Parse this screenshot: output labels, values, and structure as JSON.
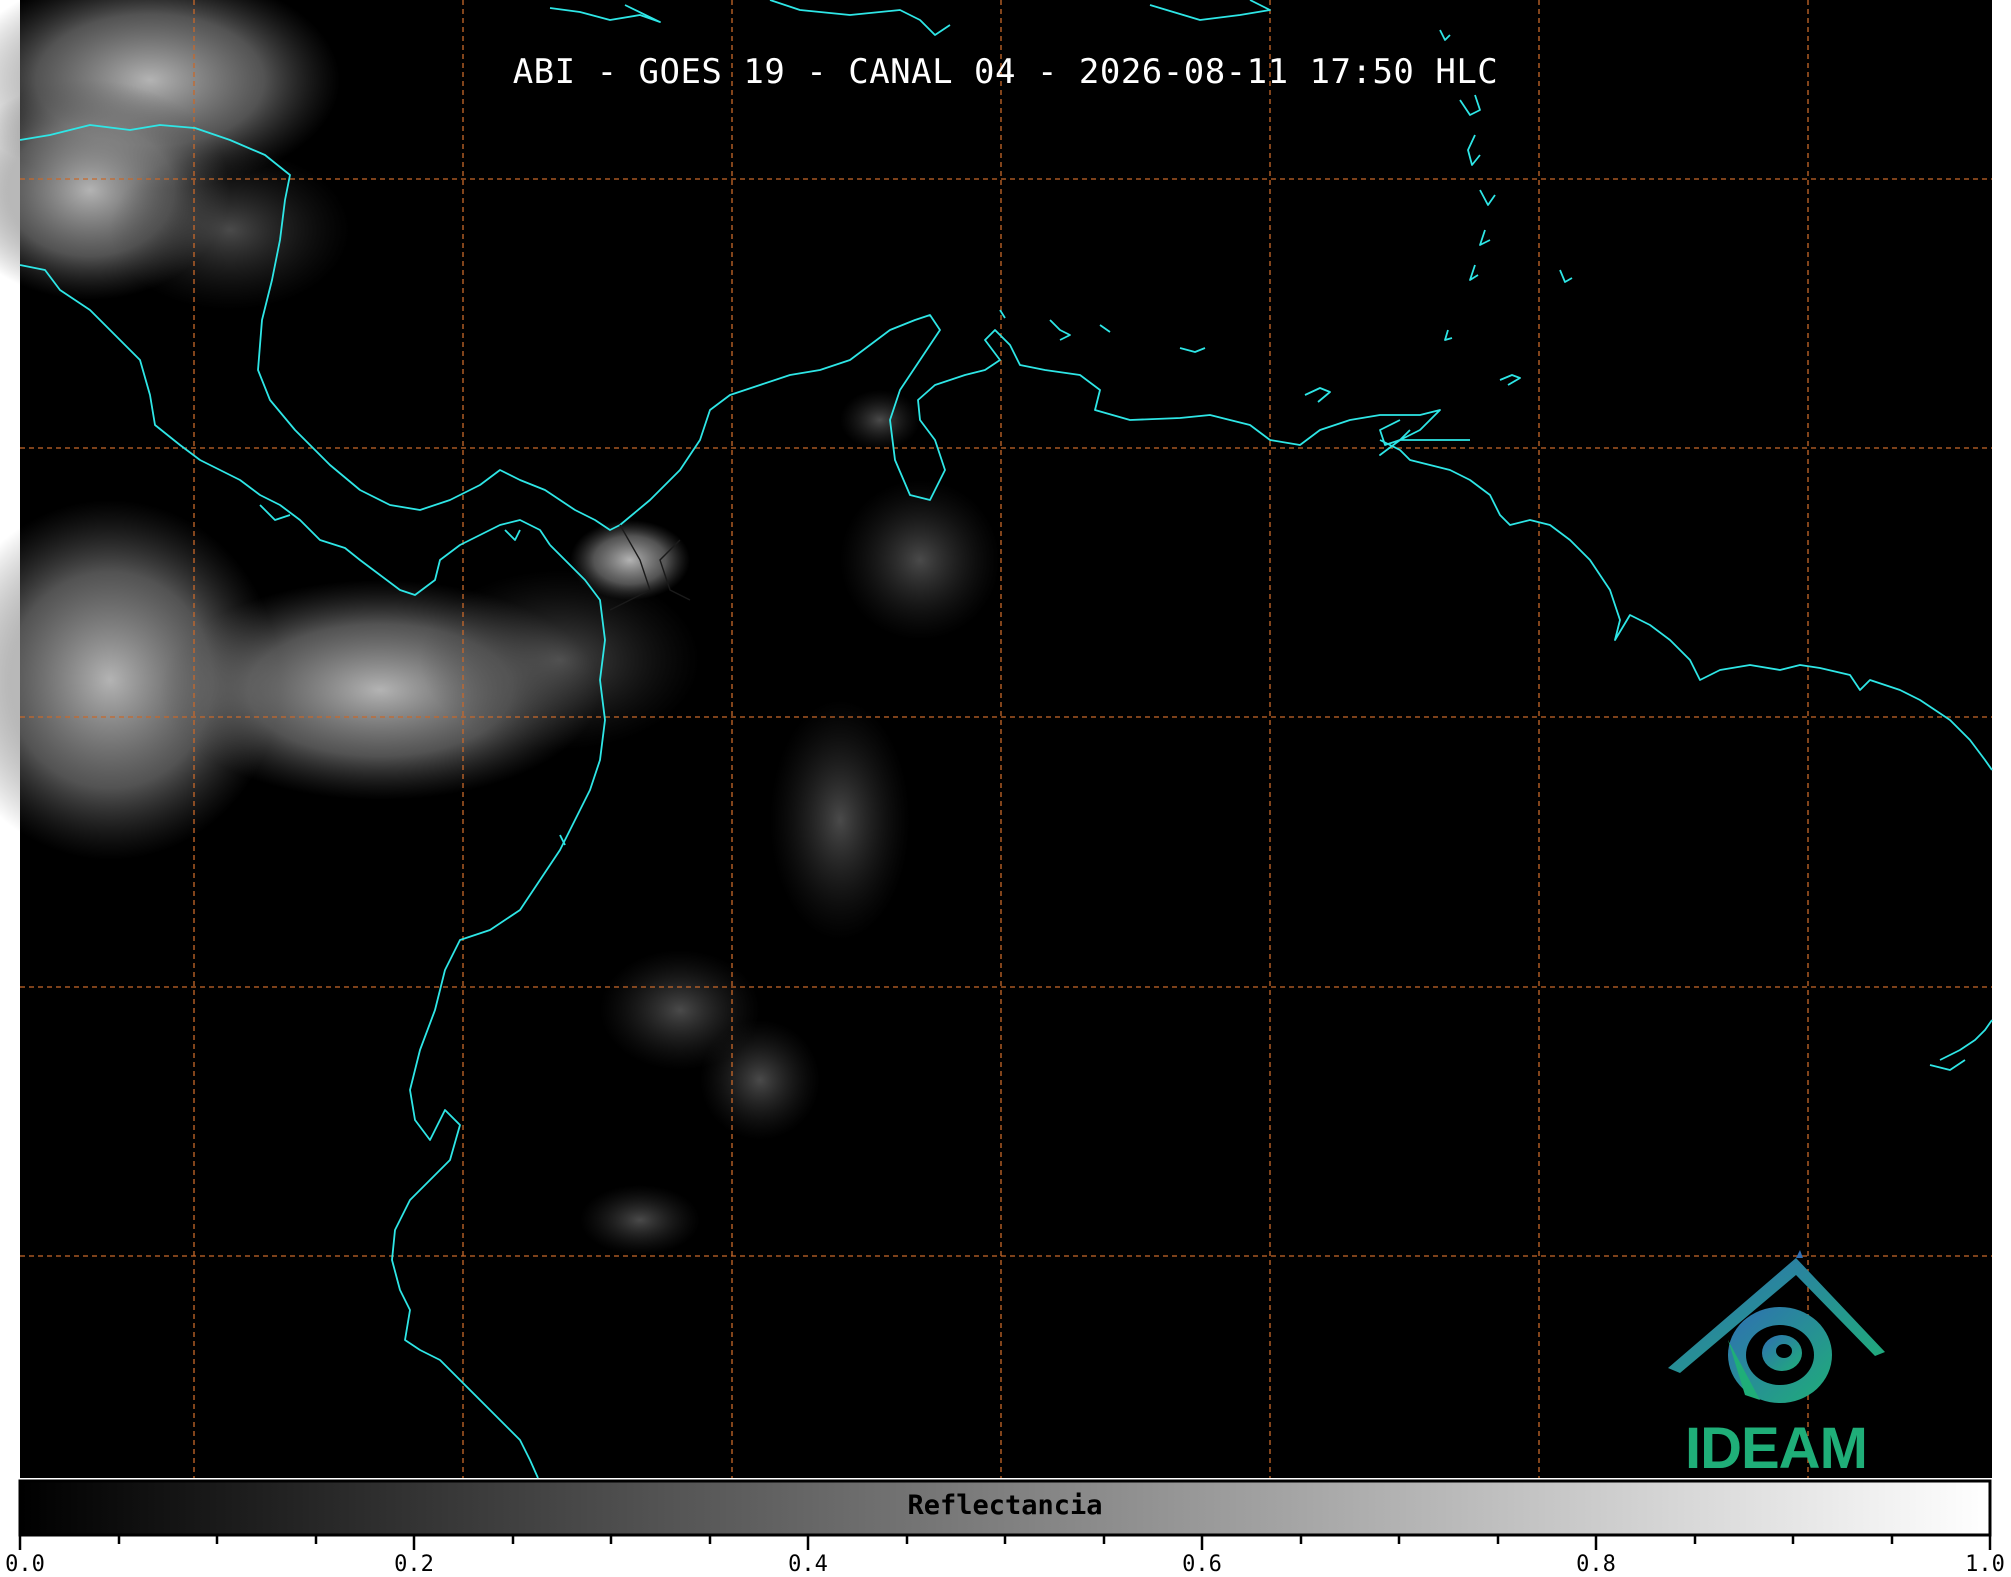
{
  "title": "ABI - GOES 19 - CANAL 04 - 2026-08-11 17:50 HLC",
  "colorbar": {
    "label": "Reflectancia",
    "ticks": [
      "0.0",
      "0.2",
      "0.4",
      "0.6",
      "0.8",
      "1.0"
    ],
    "range": [
      0.0,
      1.0
    ],
    "colormap": [
      "#000000",
      "#ffffff"
    ]
  },
  "colors": {
    "background": "#000000",
    "coastline": "#2ee6e6",
    "gridlines": "#c8682a",
    "logo": "#1fae78"
  },
  "logo": {
    "text": "IDEAM"
  }
}
